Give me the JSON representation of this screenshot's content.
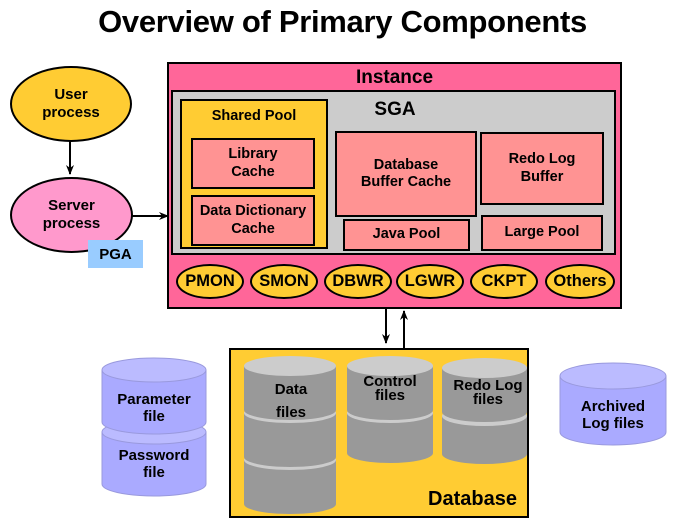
{
  "title": "Overview of Primary Components",
  "colors": {
    "instance": "#ff6699",
    "sga": "#cccccc",
    "shared_pool": "#ffcc33",
    "memory_area": "#ff9393",
    "process": "#ffcc33",
    "user_process": "#ffcc33",
    "server_process": "#ff99cc",
    "pga": "#99ccff",
    "database": "#ffcc33",
    "db_file_top": "#cccccc",
    "db_file_body": "#999999",
    "external_file": "#aaaaff"
  },
  "left": {
    "user_process": "User process",
    "user_process_lines": [
      "User",
      "process"
    ],
    "server_process_lines": [
      "Server",
      "process"
    ],
    "pga": "PGA"
  },
  "instance": {
    "label": "Instance",
    "sga": {
      "label": "SGA",
      "shared_pool": {
        "label": "Shared Pool",
        "library_cache_lines": [
          "Library",
          "Cache"
        ],
        "data_dictionary_cache_lines": [
          "Data Dictionary",
          "Cache"
        ]
      },
      "database_buffer_cache_lines": [
        "Database",
        "Buffer Cache"
      ],
      "redo_log_buffer_lines": [
        "Redo Log",
        "Buffer"
      ],
      "java_pool": "Java Pool",
      "large_pool": "Large Pool"
    },
    "background_processes": [
      "PMON",
      "SMON",
      "DBWR",
      "LGWR",
      "CKPT",
      "Others"
    ]
  },
  "database": {
    "label": "Database",
    "data_files_lines": [
      "Data",
      "files"
    ],
    "control_files_lines": [
      "Control",
      "files"
    ],
    "redo_log_files_lines": [
      "Redo Log",
      "files"
    ]
  },
  "external_files": {
    "parameter_file_lines": [
      "Parameter",
      "file"
    ],
    "password_file_lines": [
      "Password",
      "file"
    ],
    "archived_log_files_lines": [
      "Archived",
      "Log files"
    ]
  }
}
